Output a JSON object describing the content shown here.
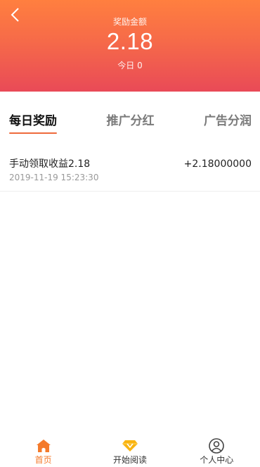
{
  "header": {
    "title": "奖励金额",
    "amount": "2.18",
    "today": "今日 0"
  },
  "tabs": [
    {
      "label": "每日奖励",
      "active": true
    },
    {
      "label": "推广分红",
      "active": false
    },
    {
      "label": "广告分润",
      "active": false
    }
  ],
  "records": [
    {
      "title": "手动领取收益2.18",
      "time": "2019-11-19 15:23:30",
      "amount": "+2.18000000"
    }
  ],
  "bottom_nav": [
    {
      "label": "首页",
      "icon": "home-icon",
      "active": true
    },
    {
      "label": "开始阅读",
      "icon": "diamond-icon",
      "active": false
    },
    {
      "label": "个人中心",
      "icon": "user-icon",
      "active": false
    }
  ],
  "colors": {
    "header_gradient_top": "#ff7f3f",
    "header_gradient_bottom": "#e94a57",
    "accent": "#f47a2b",
    "tab_underline": "#ee6a3c"
  }
}
